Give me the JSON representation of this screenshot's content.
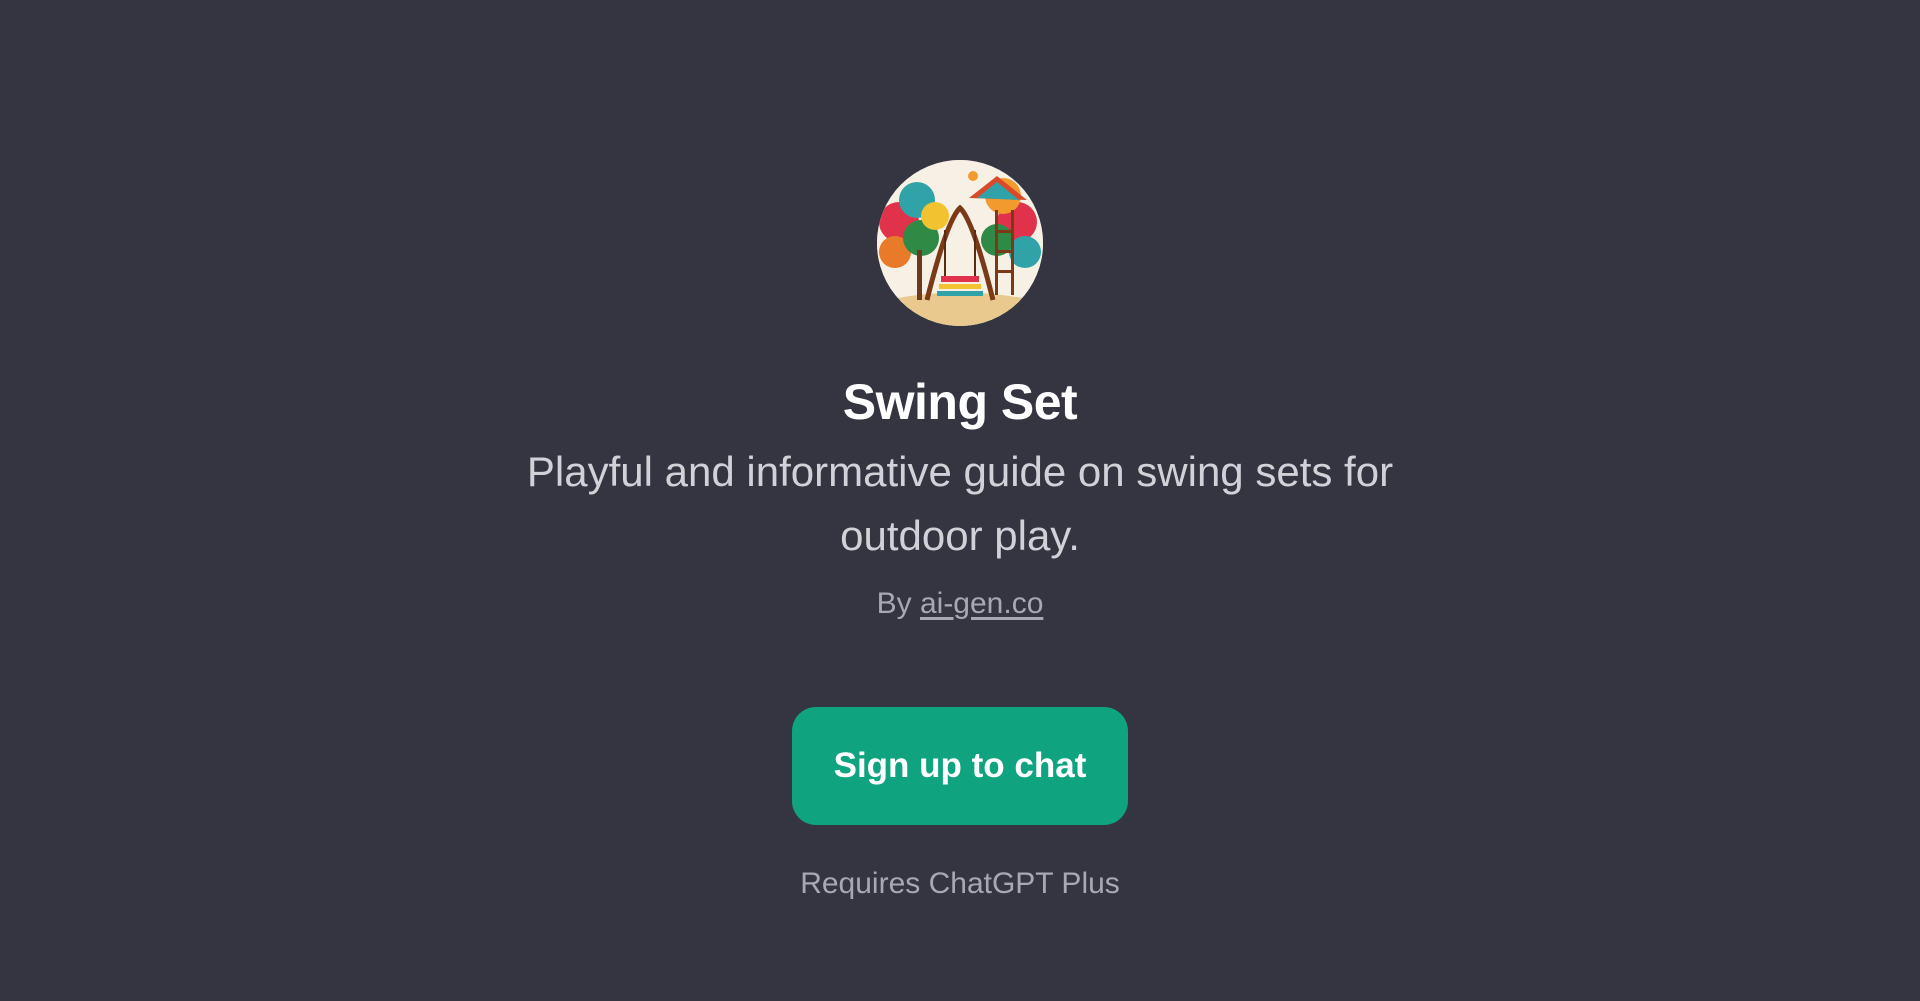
{
  "gpt": {
    "avatar_icon": "swing-set-illustration",
    "name": "Swing Set",
    "description": "Playful and informative guide on swing sets for outdoor play.",
    "by_prefix": "By",
    "author": "ai-gen.co"
  },
  "cta": {
    "label": "Sign up to chat"
  },
  "requirement": "Requires ChatGPT Plus",
  "colors": {
    "background": "#343541",
    "accent": "#10a37f",
    "title": "#ffffff",
    "muted": "#a8a8b3"
  }
}
